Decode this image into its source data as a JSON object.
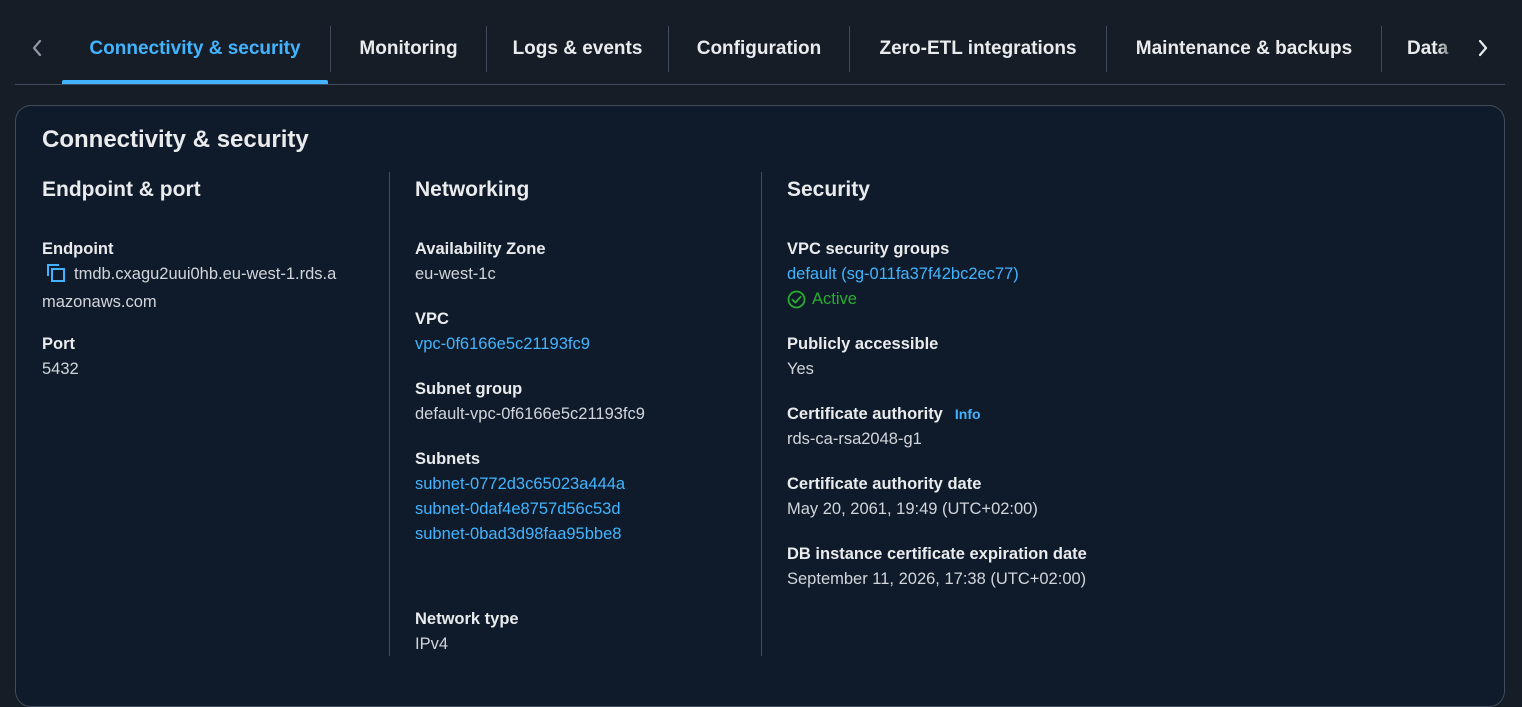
{
  "tabs": {
    "items": [
      {
        "label": "Connectivity & security",
        "active": true
      },
      {
        "label": "Monitoring",
        "active": false
      },
      {
        "label": "Logs & events",
        "active": false
      },
      {
        "label": "Configuration",
        "active": false
      },
      {
        "label": "Zero-ETL integrations",
        "active": false
      },
      {
        "label": "Maintenance & backups",
        "active": false
      },
      {
        "label": "Data",
        "active": false
      }
    ],
    "prev_icon": "chevron-left-icon",
    "next_icon": "chevron-right-icon"
  },
  "panel": {
    "title": "Connectivity & security",
    "endpoint_port": {
      "heading": "Endpoint & port",
      "endpoint_label": "Endpoint",
      "endpoint_line1": "tmdb.cxagu2uui0hb.eu-west-1.rds.a",
      "endpoint_line2": "mazonaws.com",
      "port_label": "Port",
      "port_value": "5432"
    },
    "networking": {
      "heading": "Networking",
      "az_label": "Availability Zone",
      "az_value": "eu-west-1c",
      "vpc_label": "VPC",
      "vpc_value": "vpc-0f6166e5c21193fc9",
      "subnet_group_label": "Subnet group",
      "subnet_group_value": "default-vpc-0f6166e5c21193fc9",
      "subnets_label": "Subnets",
      "subnets": [
        "subnet-0772d3c65023a444a",
        "subnet-0daf4e8757d56c53d",
        "subnet-0bad3d98faa95bbe8"
      ],
      "network_type_label": "Network type",
      "network_type_value": "IPv4"
    },
    "security": {
      "heading": "Security",
      "sg_label": "VPC security groups",
      "sg_value": "default (sg-011fa37f42bc2ec77)",
      "sg_status": "Active",
      "public_label": "Publicly accessible",
      "public_value": "Yes",
      "ca_label": "Certificate authority",
      "ca_info": "Info",
      "ca_value": "rds-ca-rsa2048-g1",
      "ca_date_label": "Certificate authority date",
      "ca_date_value": "May 20, 2061, 19:49 (UTC+02:00)",
      "cert_exp_label": "DB instance certificate expiration date",
      "cert_exp_value": "September 11, 2026, 17:38 (UTC+02:00)"
    }
  },
  "colors": {
    "accent": "#42b4ff",
    "success": "#29ad32",
    "border": "#414d5c"
  }
}
